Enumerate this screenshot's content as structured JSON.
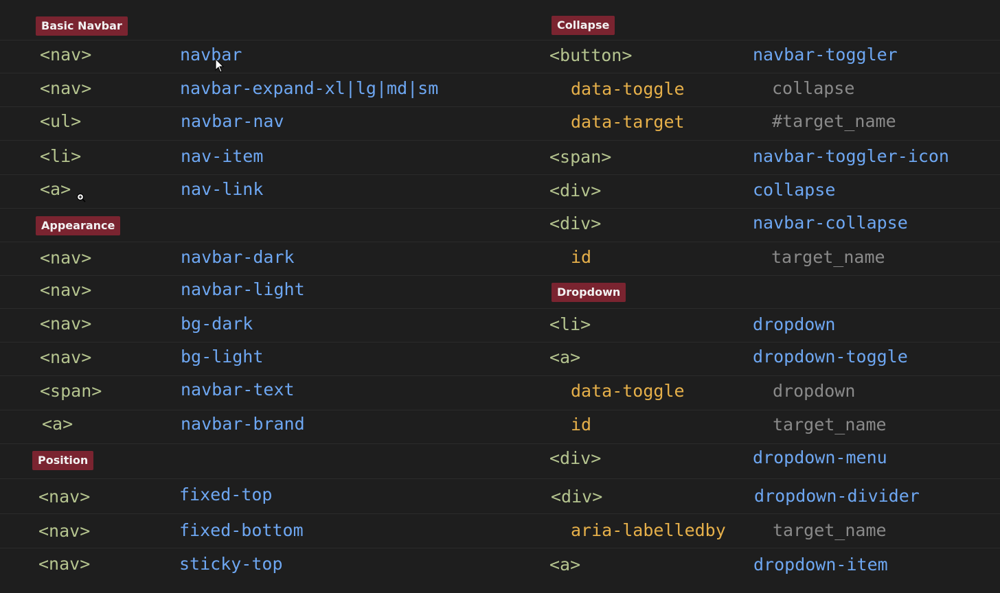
{
  "sections": {
    "basic_navbar": "Basic Navbar",
    "appearance": "Appearance",
    "position": "Position",
    "collapse": "Collapse",
    "dropdown": "Dropdown"
  },
  "left": {
    "basic": [
      {
        "tag": "<nav>",
        "value": "navbar"
      },
      {
        "tag": "<nav>",
        "value": "navbar-expand-xl|lg|md|sm"
      },
      {
        "tag": "<ul>",
        "value": "navbar-nav"
      },
      {
        "tag": "<li>",
        "value": "nav-item"
      },
      {
        "tag": "<a>",
        "value": "nav-link"
      }
    ],
    "appearance": [
      {
        "tag": "<nav>",
        "value": "navbar-dark"
      },
      {
        "tag": "<nav>",
        "value": "navbar-light"
      },
      {
        "tag": "<nav>",
        "value": "bg-dark"
      },
      {
        "tag": "<nav>",
        "value": "bg-light"
      },
      {
        "tag": "<span>",
        "value": "navbar-text"
      },
      {
        "tag": "<a>",
        "value": "navbar-brand"
      }
    ],
    "position": [
      {
        "tag": "<nav>",
        "value": "fixed-top"
      },
      {
        "tag": "<nav>",
        "value": "fixed-bottom"
      },
      {
        "tag": "<nav>",
        "value": "sticky-top"
      }
    ]
  },
  "right": {
    "collapse": [
      {
        "tag": "<button>",
        "value": "navbar-toggler"
      },
      {
        "attr": "data-toggle",
        "value": "collapse"
      },
      {
        "attr": "data-target",
        "value": "#target_name"
      },
      {
        "tag": "<span>",
        "value": "navbar-toggler-icon"
      },
      {
        "tag": "<div>",
        "value": "collapse"
      },
      {
        "tag": "<div>",
        "value": "navbar-collapse"
      },
      {
        "attr": "id",
        "value": "target_name"
      }
    ],
    "dropdown": [
      {
        "tag": "<li>",
        "value": "dropdown"
      },
      {
        "tag": "<a>",
        "value": "dropdown-toggle"
      },
      {
        "attr": "data-toggle",
        "value": "dropdown"
      },
      {
        "attr": "id",
        "value": "target_name"
      },
      {
        "tag": "<div>",
        "value": "dropdown-menu"
      },
      {
        "tag": "<div>",
        "value": "dropdown-divider"
      },
      {
        "attr": "aria-labelledby",
        "value": "target_name"
      },
      {
        "tag": "<a>",
        "value": "dropdown-item"
      }
    ]
  },
  "colors": {
    "background": "#1e1e1e",
    "tag": "#b5c48f",
    "class": "#6ea7f2",
    "attribute": "#e6b04a",
    "attribute_value": "#8a8a8a",
    "badge": "#7a2430"
  },
  "icons": [
    "mouse-pointer-icon",
    "zoom-cursor-icon"
  ]
}
